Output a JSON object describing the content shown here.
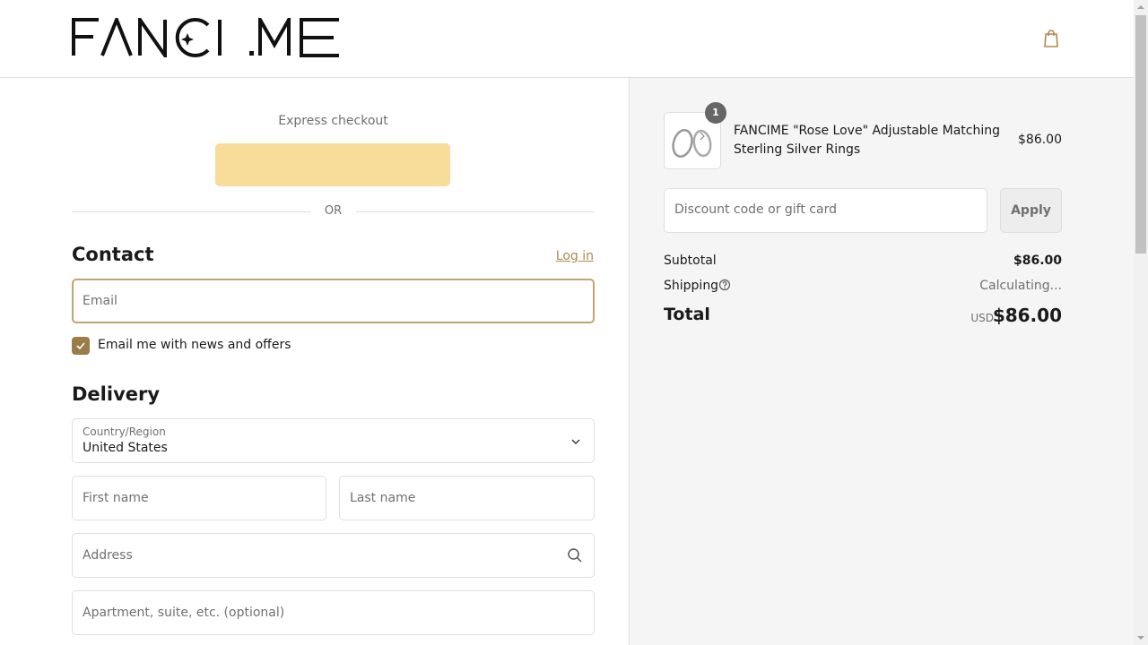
{
  "brand": {
    "logo_text": "FANCI.ME",
    "accent": "#b0894f",
    "express_color": "#f7dc9a"
  },
  "express": {
    "label": "Express checkout",
    "or_label": "OR"
  },
  "contact": {
    "heading": "Contact",
    "login_label": "Log in",
    "email_placeholder": "Email",
    "email_value": "",
    "newsletter_label": "Email me with news and offers",
    "newsletter_checked": true
  },
  "delivery": {
    "heading": "Delivery",
    "country_label": "Country/Region",
    "country_value": "United States",
    "first_name_placeholder": "First name",
    "last_name_placeholder": "Last name",
    "address_placeholder": "Address",
    "apartment_placeholder": "Apartment, suite, etc. (optional)"
  },
  "order": {
    "items": [
      {
        "name": "FANCIME \"Rose Love\" Adjustable Matching Sterling Silver Rings",
        "price": "$86.00",
        "quantity": "1"
      }
    ],
    "discount_placeholder": "Discount code or gift card",
    "apply_label": "Apply",
    "subtotal_label": "Subtotal",
    "subtotal_value": "$86.00",
    "shipping_label": "Shipping",
    "shipping_value": "Calculating...",
    "total_label": "Total",
    "total_currency": "USD",
    "total_value": "$86.00"
  }
}
